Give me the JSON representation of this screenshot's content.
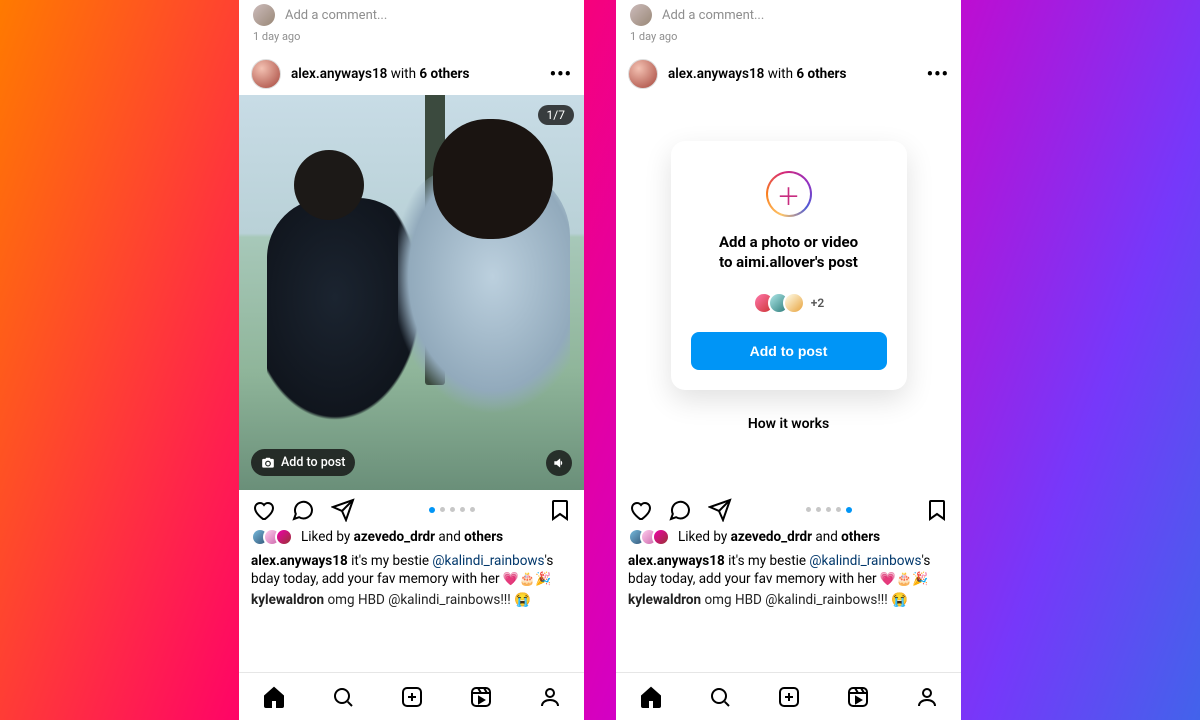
{
  "prev": {
    "comment_placeholder": "Add a comment...",
    "ago": "1 day ago"
  },
  "post": {
    "username": "alex.anyways18",
    "with_text": " with ",
    "others": "6 others",
    "counter": "1/7",
    "add_chip": "Add to post",
    "carousel": {
      "total_dots": 5,
      "active_left": 1,
      "active_right": 5
    }
  },
  "likes": {
    "prefix": "Liked by ",
    "who": "azevedo_drdr",
    "suffix": " and ",
    "others": "others"
  },
  "caption": {
    "user": "alex.anyways18",
    "text_a": " it's my bestie ",
    "mention": "@kalindi_rainbows",
    "text_b": "'s bday today, add your fav memory with her ",
    "emojis": "💗🎂🎉"
  },
  "comment": {
    "user": "kylewaldron",
    "text": " omg HBD ",
    "mention": "@kalindi_rainbows",
    "tail": "!!!   😭"
  },
  "card": {
    "title_a": "Add a photo or video",
    "title_b": "to aimi.allover's post",
    "more": "+2",
    "button": "Add to post",
    "how": "How it works"
  },
  "nav": {
    "home": "home",
    "search": "search",
    "create": "create",
    "reels": "reels",
    "profile": "profile"
  }
}
